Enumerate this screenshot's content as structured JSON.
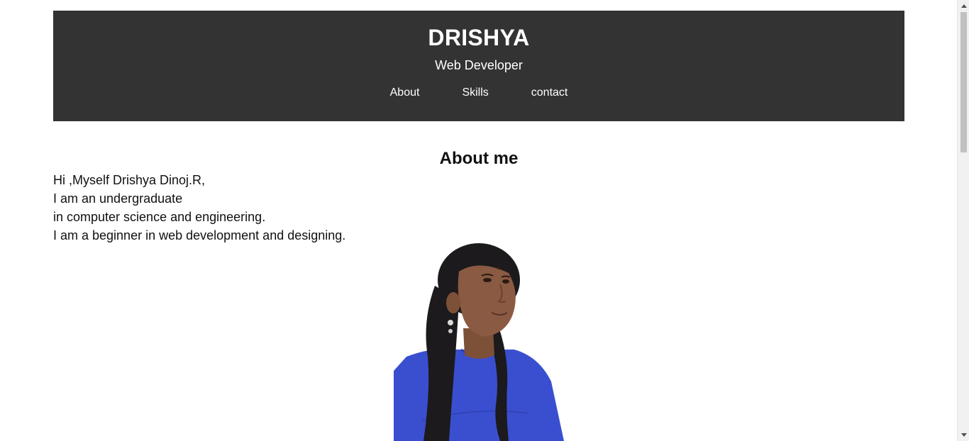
{
  "header": {
    "name": "DRISHYA",
    "role": "Web Developer",
    "nav": [
      {
        "label": "About"
      },
      {
        "label": "Skills"
      },
      {
        "label": "contact"
      }
    ]
  },
  "about": {
    "title": "About me",
    "lines": [
      "Hi ,Myself Drishya Dinoj.R,",
      "I am an undergraduate",
      "in computer science and engineering.",
      "I am a beginner in web development and designing."
    ]
  },
  "colors": {
    "header_bg": "#333333",
    "header_text": "#ffffff",
    "body_text": "#111111",
    "shirt": "#3a4fd0",
    "hair": "#1c1a1c",
    "skin": "#8a5a43"
  },
  "icons": {
    "scroll_up": "triangle-up-icon",
    "scroll_down": "triangle-down-icon"
  }
}
